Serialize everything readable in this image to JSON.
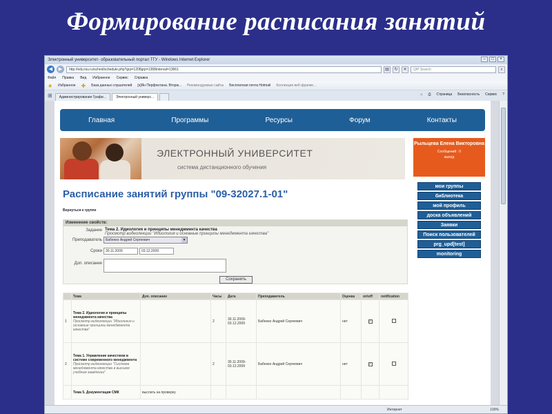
{
  "slide": {
    "title": "Формирование расписания занятий"
  },
  "browser": {
    "window_title": "Электронный университет- образовательный портал ТГУ - Windows Internet Explorer",
    "url": "http://edu.tsu.ru/sched/schedule.php?grp=1208grp=1368interval=13661",
    "search_placeholder": "QIP Search",
    "menu": [
      "Файл",
      "Правка",
      "Вид",
      "Избранное",
      "Сервис",
      "Справка"
    ],
    "favorites": {
      "label": "Избранное",
      "items": [
        "База данных слушателей",
        "[s]Ян Перфонтана. Вторж...",
        "Рекомендуемые сайты",
        "Бесплатная почта Hotmail",
        "Коллекция веб-фрагме..."
      ]
    },
    "tabs": [
      {
        "label": "Администрирование Графи..."
      },
      {
        "label": "Электронный универс..."
      }
    ],
    "tools": [
      "Страница",
      "Безопасность",
      "Сервис"
    ],
    "status": {
      "zone": "Интернет",
      "zoom": "100%"
    }
  },
  "site": {
    "nav": [
      "Главная",
      "Программы",
      "Ресурсы",
      "Форум",
      "Контакты"
    ],
    "banner": {
      "title": "ЭЛЕКТРОННЫЙ УНИВЕРСИТЕТ",
      "subtitle": "система дистанционного обучения"
    },
    "user": {
      "name": "Рыльцева Елена Викторовна",
      "messages": "Сообщений : 0",
      "exit": "выход"
    },
    "side_menu": [
      "мои группы",
      "библиотека",
      "мой профиль",
      "доска объявлений",
      "Заявки",
      "Поиск пользователей",
      "prg_upd[test]",
      "monitoring"
    ],
    "heading": "Расписание занятий группы \"09-32027.1-01\"",
    "back_link": "Вернуться к группе",
    "edit": {
      "header": "Изменение свойств:",
      "task_label": "Задание",
      "task_title": "Тема 2. Идиология и принципы менеджмента качества",
      "task_sub": "Просмотр видеолекции \"Идиология и основные принципы менеджмента качества\"",
      "teacher_label": "Преподаватель",
      "teacher_value": "Бабенко Андрей Сергеевич",
      "dates_label": "Сроки",
      "date_from": "30.11.2009",
      "date_to": "03.12.2009",
      "desc_label": "Доп. описание",
      "save_label": "Сохранить"
    },
    "table": {
      "headers": [
        "Тема",
        "Доп. описание",
        "Часы",
        "Дата",
        "Преподаватель",
        "Оценка",
        "on\\off",
        "notification"
      ],
      "rows": [
        {
          "num": "1",
          "title": "Тема 2. Идиология и принципы менеджмента качества",
          "sub": "Просмотр видеолекции \"Идиология и основные принципы менеджмента качества\"",
          "desc": "",
          "hours": "2",
          "date": "30.11.2009-03.12.2009",
          "teacher": "Бабенко Андрей Сергеевич",
          "grade": "нет",
          "on": true,
          "notify": false
        },
        {
          "num": "2",
          "title": "Тема 1. Управление качеством в системе современного менеджмента",
          "sub": "Просмотр видеолекции \"Система менеджмента качества в высшем учебном заведении\"",
          "desc": "",
          "hours": "2",
          "date": "30.11.2009-03.12.2009",
          "teacher": "Бабенко Андрей Сергеевич",
          "grade": "нет",
          "on": true,
          "notify": false
        },
        {
          "num": "",
          "title": "Тема 5. Документация СМК",
          "sub": "",
          "desc": "выслать на проверку",
          "hours": "",
          "date": "",
          "teacher": "",
          "grade": "",
          "on": false,
          "notify": false
        }
      ]
    }
  }
}
